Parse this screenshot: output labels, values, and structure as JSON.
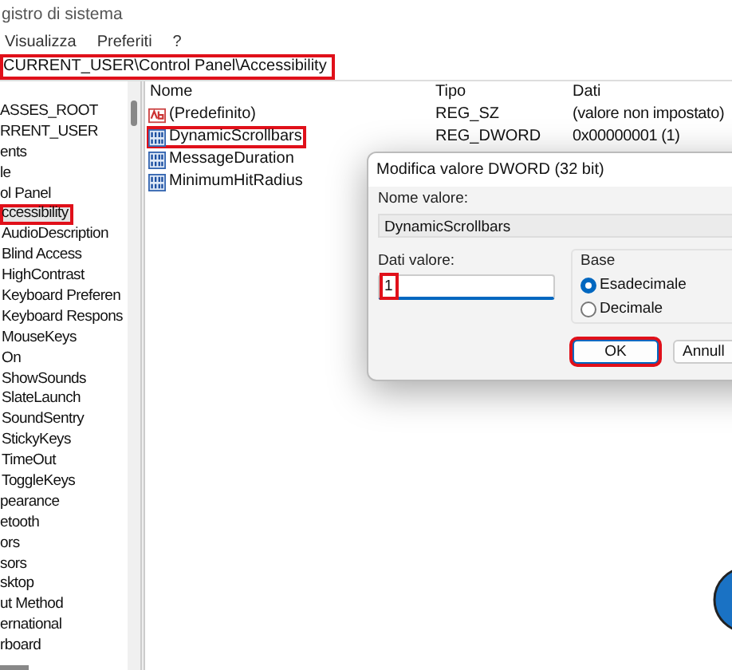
{
  "window": {
    "title": "gistro di sistema"
  },
  "menu": [
    {
      "label": "Visualizza"
    },
    {
      "label": "Preferiti"
    },
    {
      "label": "?"
    }
  ],
  "address": {
    "value": "CURRENT_USER\\Control Panel\\Accessibility",
    "highlighted": true
  },
  "tree": [
    {
      "label": "ASSES_ROOT",
      "selected": false,
      "highlighted": false
    },
    {
      "label": "RRENT_USER",
      "selected": false,
      "highlighted": false,
      "children": [
        {
          "label": "ents",
          "selected": false,
          "highlighted": false
        },
        {
          "label": "le",
          "selected": false,
          "highlighted": false
        },
        {
          "label": "ol Panel",
          "selected": false,
          "highlighted": false,
          "children": [
            {
              "label": "ccessibility",
              "selected": true,
              "highlighted": true,
              "children": [
                {
                  "label": "AudioDescription",
                  "selected": false,
                  "highlighted": false
                },
                {
                  "label": "Blind Access",
                  "selected": false,
                  "highlighted": false
                },
                {
                  "label": "HighContrast",
                  "selected": false,
                  "highlighted": false
                },
                {
                  "label": "Keyboard Preferen",
                  "selected": false,
                  "highlighted": false
                },
                {
                  "label": "Keyboard Respons",
                  "selected": false,
                  "highlighted": false
                },
                {
                  "label": "MouseKeys",
                  "selected": false,
                  "highlighted": false
                },
                {
                  "label": "On",
                  "selected": false,
                  "highlighted": false
                },
                {
                  "label": "ShowSounds",
                  "selected": false,
                  "highlighted": false
                },
                {
                  "label": "SlateLaunch",
                  "selected": false,
                  "highlighted": false
                },
                {
                  "label": "SoundSentry",
                  "selected": false,
                  "highlighted": false
                },
                {
                  "label": "StickyKeys",
                  "selected": false,
                  "highlighted": false
                },
                {
                  "label": "TimeOut",
                  "selected": false,
                  "highlighted": false
                },
                {
                  "label": "ToggleKeys",
                  "selected": false,
                  "highlighted": false
                }
              ]
            },
            {
              "label": "pearance",
              "selected": false,
              "highlighted": false
            },
            {
              "label": "etooth",
              "selected": false,
              "highlighted": false
            },
            {
              "label": "ors",
              "selected": false,
              "highlighted": false
            },
            {
              "label": "sors",
              "selected": false,
              "highlighted": false
            },
            {
              "label": "sktop",
              "selected": false,
              "highlighted": false
            },
            {
              "label": "ut Method",
              "selected": false,
              "highlighted": false
            },
            {
              "label": "ernational",
              "selected": false,
              "highlighted": false
            },
            {
              "label": "rboard",
              "selected": false,
              "highlighted": false
            }
          ]
        }
      ]
    }
  ],
  "list": {
    "columns": [
      "Nome",
      "Tipo",
      "Dati"
    ],
    "rows": [
      {
        "kind": "string",
        "name": "(Predefinito)",
        "type": "REG_SZ",
        "data": "(valore non impostato)",
        "highlighted": false
      },
      {
        "kind": "dword",
        "name": "DynamicScrollbars",
        "type": "REG_DWORD",
        "data": "0x00000001 (1)",
        "highlighted": true
      },
      {
        "kind": "dword",
        "name": "MessageDuration",
        "highlighted": false
      },
      {
        "kind": "dword",
        "name": "MinimumHitRadius",
        "highlighted": false
      }
    ]
  },
  "dialog": {
    "title": "Modifica valore DWORD (32 bit)",
    "name_label": "Nome valore:",
    "name_value": "DynamicScrollbars",
    "data_label": "Dati valore:",
    "data_value": "1",
    "data_highlighted": true,
    "base_label": "Base",
    "radios": [
      {
        "label": "Esadecimale",
        "selected": true
      },
      {
        "label": "Decimale",
        "selected": false
      }
    ],
    "buttons": [
      {
        "label": "OK",
        "default": true,
        "highlighted": true
      },
      {
        "label": "Annull",
        "default": false,
        "highlighted": false
      }
    ]
  }
}
